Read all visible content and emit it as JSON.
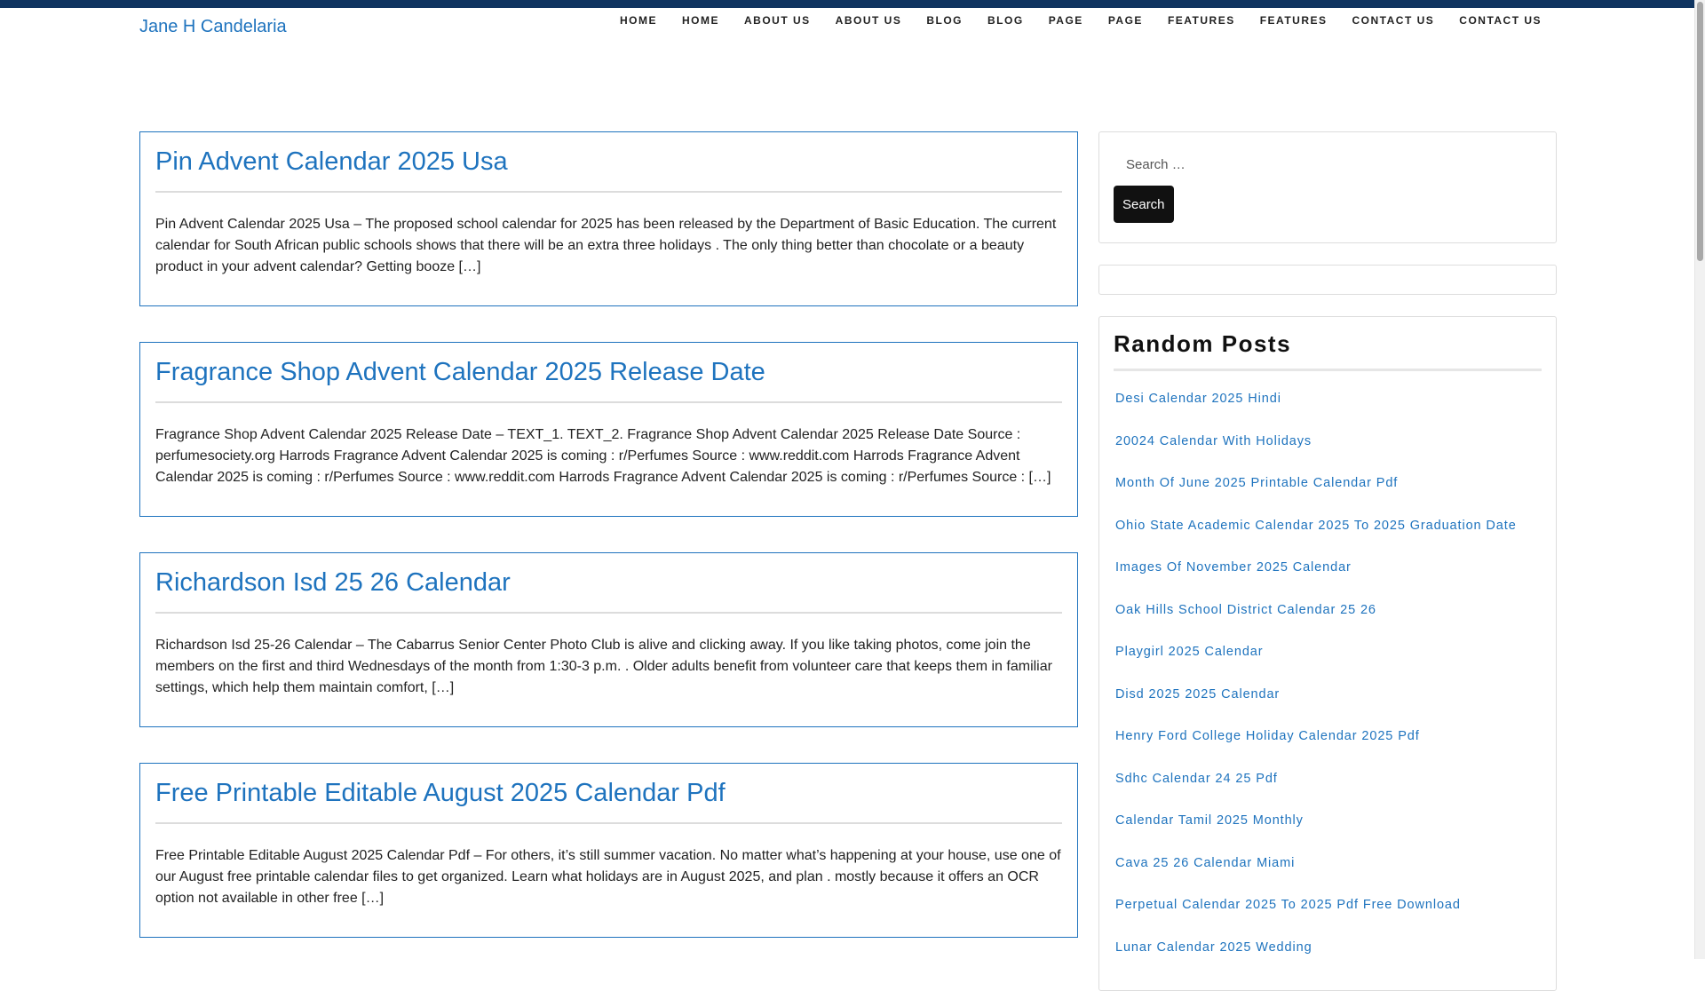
{
  "site": {
    "title": "Jane H Candelaria"
  },
  "nav": {
    "items": [
      "Home",
      "Home",
      "About Us",
      "About Us",
      "Blog",
      "Blog",
      "Page",
      "Page",
      "Features",
      "Features",
      "Contact Us",
      "Contact Us"
    ]
  },
  "posts": [
    {
      "title": "Pin Advent Calendar 2025 Usa",
      "excerpt": "Pin Advent Calendar 2025 Usa – The proposed school calendar for 2025 has been released by the Department of Basic Education. The current calendar for South African public schools shows that there will be an extra three holidays . The only thing better than chocolate or a beauty product in your advent calendar? Getting booze […]"
    },
    {
      "title": "Fragrance Shop Advent Calendar 2025 Release Date",
      "excerpt": "Fragrance Shop Advent Calendar 2025 Release Date – TEXT_1. TEXT_2. Fragrance Shop Advent Calendar 2025 Release Date Source : perfumesociety.org Harrods Fragrance Advent Calendar 2025 is coming : r/Perfumes Source : www.reddit.com Harrods Fragrance Advent Calendar 2025 is coming : r/Perfumes Source : www.reddit.com Harrods Fragrance Advent Calendar 2025 is coming : r/Perfumes Source : […]"
    },
    {
      "title": "Richardson Isd 25 26 Calendar",
      "excerpt": "Richardson Isd 25-26 Calendar – The Cabarrus Senior Center Photo Club is alive and clicking away. If you like taking photos, come join the members on the first and third Wednesdays of the month from 1:30-3 p.m. . Older adults benefit from volunteer care that keeps them in familiar settings, which help them maintain comfort, […]"
    },
    {
      "title": "Free Printable Editable August 2025 Calendar Pdf",
      "excerpt": "Free Printable Editable August 2025 Calendar Pdf – For others, it’s still summer vacation. No matter what’s happening at your house, use one of our August free printable calendar files to get organized. Learn what holidays are in August 2025, and plan . mostly because it offers an OCR option not available in other free […]"
    }
  ],
  "search": {
    "placeholder": "Search …",
    "button_label": "Search"
  },
  "random_posts": {
    "title": "Random Posts",
    "items": [
      "Desi Calendar 2025 Hindi",
      "20024 Calendar With Holidays",
      "Month Of June 2025 Printable Calendar Pdf",
      "Ohio State Academic Calendar 2025 To 2025 Graduation Date",
      "Images Of November 2025 Calendar",
      "Oak Hills School District Calendar 25 26",
      "Playgirl 2025 Calendar",
      "Disd 2025 2025 Calendar",
      "Henry Ford College Holiday Calendar 2025 Pdf",
      "Sdhc Calendar 24 25 Pdf",
      "Calendar Tamil 2025 Monthly",
      "Cava 25 26 Calendar Miami",
      "Perpetual Calendar 2025 To 2025 Pdf Free Download",
      "Lunar Calendar 2025 Wedding"
    ]
  },
  "colors": {
    "accent": "#1e73be",
    "topbar": "#0f3460",
    "button": "#111111"
  }
}
